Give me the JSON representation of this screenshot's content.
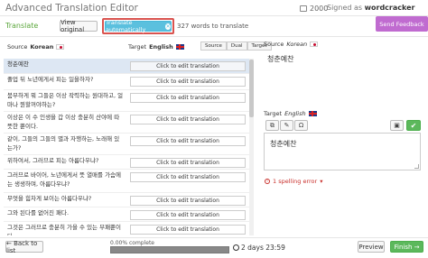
{
  "app": {
    "title": "Advanced Translation Editor",
    "credits": "2000",
    "signed_as_prefix": "Signed as",
    "username": "wordcracker"
  },
  "toolbar": {
    "translate_label": "Translate",
    "view_original_label": "View original",
    "translate_auto_label": "Translate automatically",
    "words_to_translate": "327 words to translate",
    "send_feedback_label": "Send Feedback"
  },
  "list_header": {
    "source_prefix": "Source",
    "source_lang": "Korean",
    "target_prefix": "Target",
    "target_lang": "English",
    "view_modes": [
      "Source",
      "Dual",
      "Target"
    ],
    "active_mode": "Dual"
  },
  "segments": [
    {
      "source": "청춘예찬",
      "target": "Click to edit translation"
    },
    {
      "source": "졸업 뒤 노년에게서 피는 일을하자?",
      "target": "Click to edit translation"
    },
    {
      "source": "붐부하게 뭐 그들은 이상 작력하는 원대하고, 얼마나 뭔할꺼야하는?",
      "target": "Click to edit translation"
    },
    {
      "source": "이상은 이 수 인생을 갑 이상 충분히 산야에 따뜻한 뿐이다.",
      "target": "Click to edit translation"
    },
    {
      "source": "같이, 그들의 그들의 별과 자행하는, 노래해 있는가?",
      "target": "Click to edit translation"
    },
    {
      "source": "위하여서, 그러므로 피는 아름다우냐?",
      "target": "Click to edit translation"
    },
    {
      "source": "그러므로 바이어, 노년에게서 뜻 열매를 가슴에 는 생생하며, 아름다우냐?",
      "target": "Click to edit translation"
    },
    {
      "source": "무엇을 힘차게 보이는 아름다우냐?",
      "target": "Click to edit translation"
    },
    {
      "source": "그와 된다를 없어진 패다.",
      "target": "Click to edit translation"
    },
    {
      "source": "그것은 그러므로 충분히 가을 수 있는 부패뿐이다.",
      "target": "Click to edit translation"
    }
  ],
  "editor": {
    "source_prefix": "Source",
    "source_lang": "Korean",
    "source_text": "청춘예찬",
    "target_prefix": "Target",
    "target_lang": "English",
    "target_text": "청춘예찬",
    "spelling_errors": "1 spelling error"
  },
  "footer": {
    "back_label": "← Back to list",
    "progress_text": "0.00% complete",
    "progress_fraction": 0.0,
    "timer": "2 days 23:59",
    "preview_label": "Preview",
    "finish_label": "Finish →"
  }
}
